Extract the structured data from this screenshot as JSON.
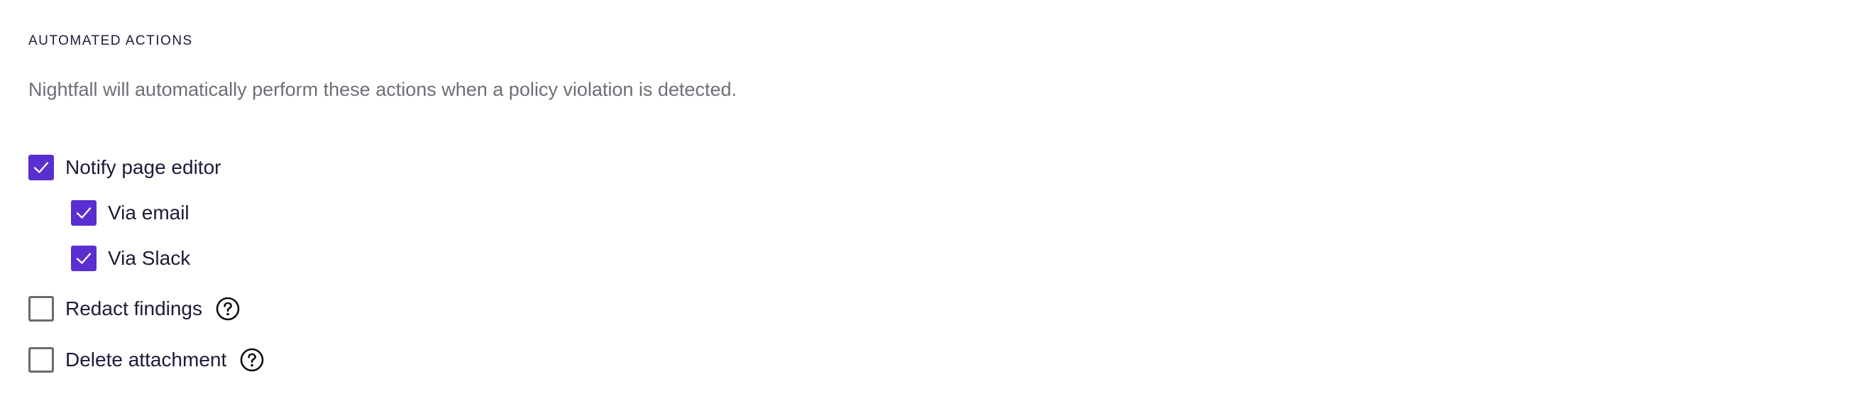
{
  "section": {
    "title": "AUTOMATED ACTIONS",
    "description": "Nightfall will automatically perform these actions when a policy violation is detected."
  },
  "options": {
    "notify_editor": {
      "label": "Notify page editor",
      "checked": true
    },
    "via_email": {
      "label": "Via email",
      "checked": true
    },
    "via_slack": {
      "label": "Via Slack",
      "checked": true
    },
    "redact_findings": {
      "label": "Redact findings",
      "checked": false,
      "help_icon": "question-circle-icon"
    },
    "delete_attachment": {
      "label": "Delete attachment",
      "checked": false,
      "help_icon": "question-circle-icon"
    }
  },
  "colors": {
    "accent": "#5a2ed1",
    "text_primary": "#1d1a3a",
    "text_secondary": "#6f6e77",
    "checkbox_border": "#6a6a72"
  }
}
